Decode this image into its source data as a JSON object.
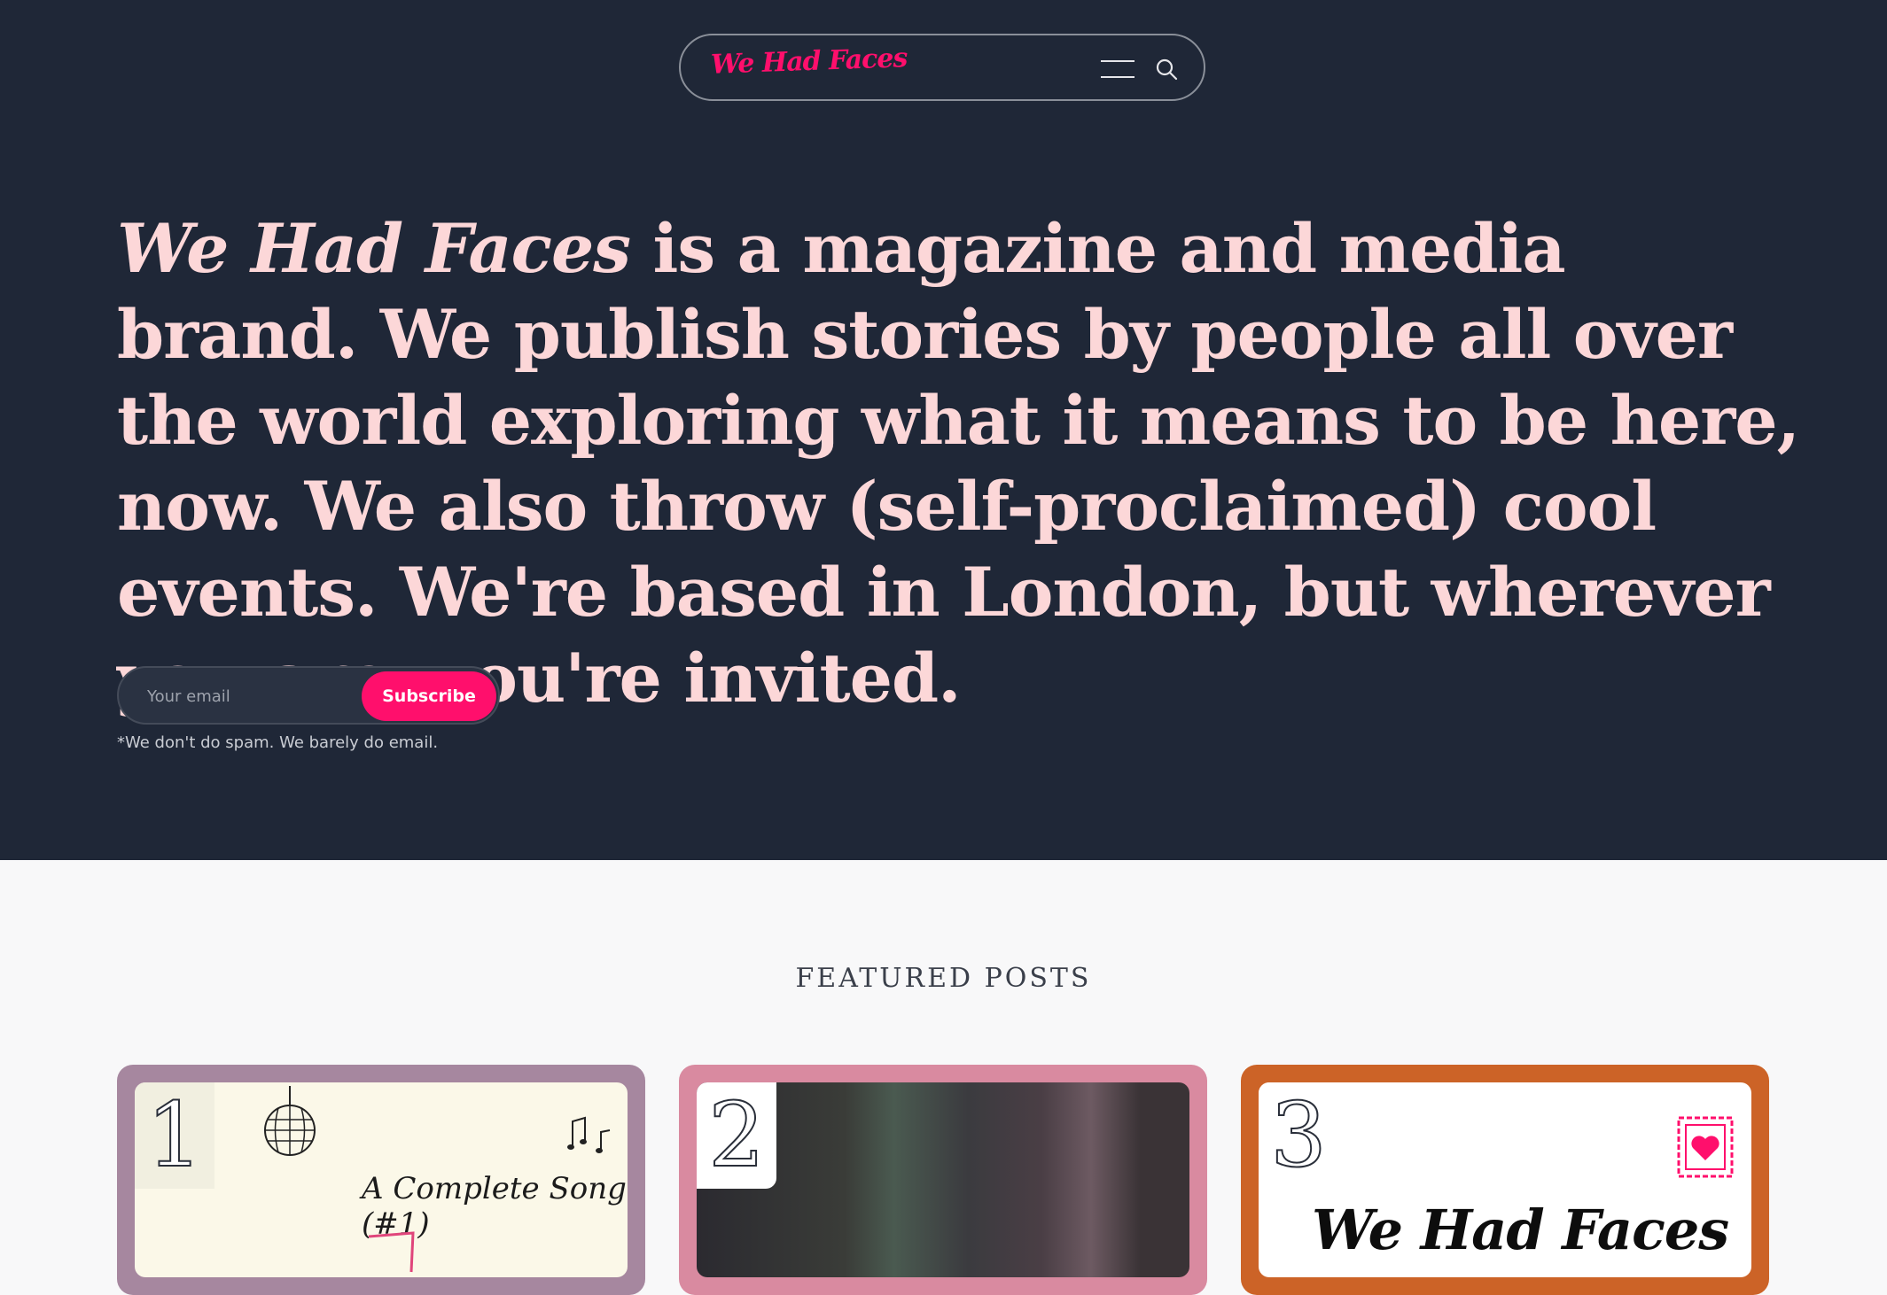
{
  "nav": {
    "logo": "We Had Faces",
    "menu_icon": "hamburger-menu-icon",
    "search_icon": "search-icon"
  },
  "hero": {
    "brand": "We Had Faces",
    "text": " is a magazine and media brand. We publish stories by people all over the world exploring what it means to be here, now. We also throw (self-proclaimed) cool events. We're based in London, but wherever you are, you're invited."
  },
  "subscribe": {
    "placeholder": "Your email",
    "button_label": "Subscribe",
    "note": "*We don't do spam. We barely do email."
  },
  "featured": {
    "title": "FEATURED POSTS",
    "posts": [
      {
        "number": "1",
        "caption": "A Complete Song (#1)",
        "accent": "#a6879f"
      },
      {
        "number": "2",
        "accent": "#d98aa0"
      },
      {
        "number": "3",
        "caption": "We Had Faces",
        "accent": "#cc6327"
      }
    ]
  },
  "colors": {
    "hero_bg": "#1f2737",
    "hero_text": "#fcd7d8",
    "brand_pink": "#ff0f6c",
    "page_bg": "#f8f8f9"
  }
}
